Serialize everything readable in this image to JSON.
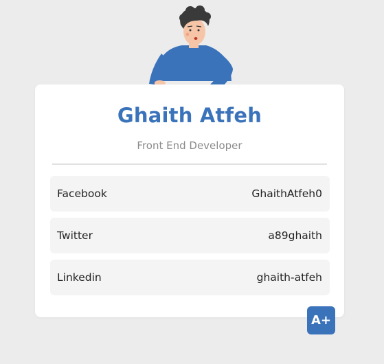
{
  "profile": {
    "name": "Ghaith Atfeh",
    "role": "Front End Developer"
  },
  "links": [
    {
      "label": "Facebook",
      "handle": "GhaithAtfeh0"
    },
    {
      "label": "Twitter",
      "handle": "a89ghaith"
    },
    {
      "label": "Linkedin",
      "handle": "ghaith-atfeh"
    }
  ],
  "font_button": {
    "label": "A+"
  },
  "colors": {
    "accent": "#3b73bb",
    "background": "#ececec",
    "card": "#ffffff",
    "row": "#f4f4f4"
  }
}
